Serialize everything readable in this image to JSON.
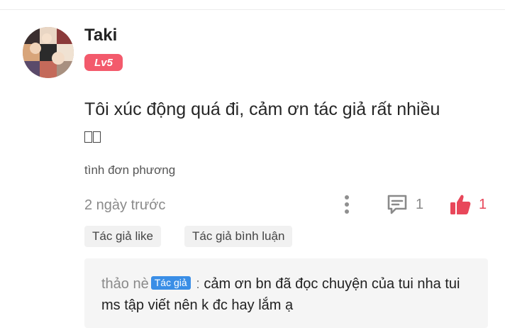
{
  "comment": {
    "username": "Taki",
    "level": "Lv5",
    "text": "Tôi xúc động quá đi, cảm ơn tác giả rất nhiều",
    "chapter": "tình đơn phương",
    "timestamp": "2 ngày trước",
    "reply_count": "1",
    "like_count": "1",
    "tags": [
      "Tác giả like",
      "Tác giả bình luận"
    ]
  },
  "author_reply": {
    "name": "thảo nè",
    "badge": "Tác giả",
    "separator": " : ",
    "text": "cảm ơn bn đã đọc chuyện của tui nha tui ms tập viết nên k đc hay lắm ạ"
  },
  "colors": {
    "level_badge": "#f35a6c",
    "like_accent": "#e8475a",
    "author_badge": "#3a8ee6"
  },
  "icons": {
    "more": "vertical-ellipsis-icon",
    "reply": "comment-bubble-icon",
    "like": "thumbs-up-icon"
  }
}
